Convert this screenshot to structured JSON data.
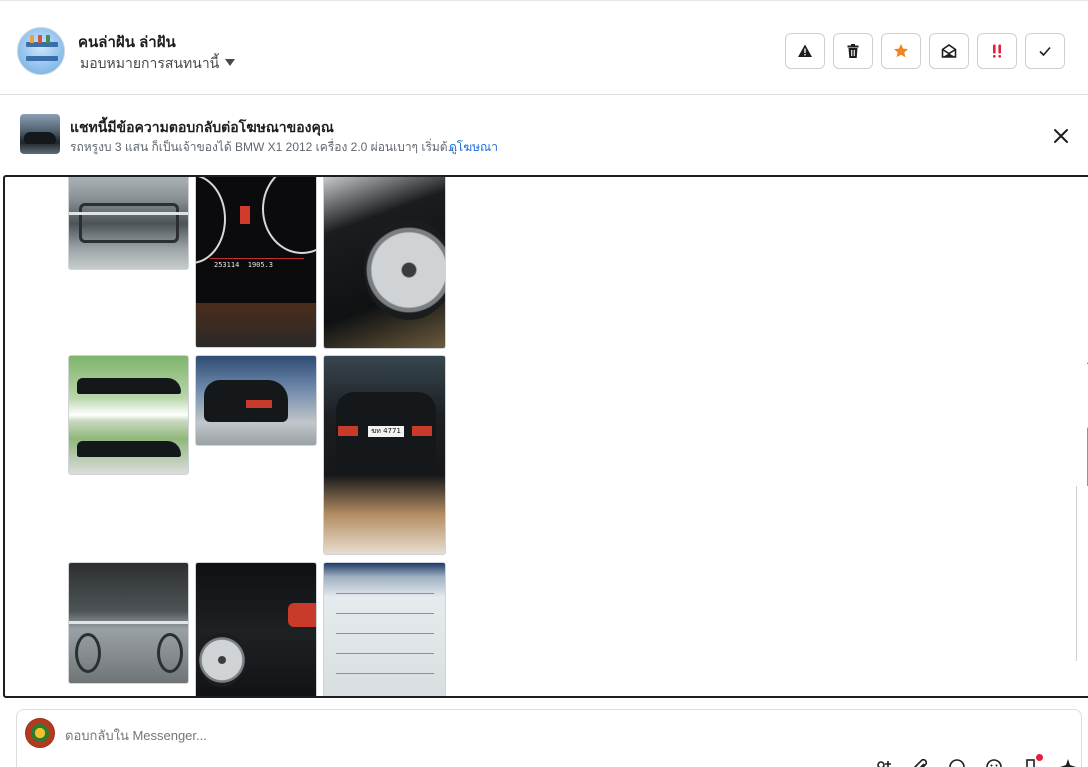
{
  "header": {
    "name": "คนล่าฝัน ล่าฝัน",
    "assign_label": "มอบหมายการสนทนานี้",
    "actions": [
      {
        "name": "report-button",
        "icon": "warning-icon"
      },
      {
        "name": "delete-button",
        "icon": "trash-icon"
      },
      {
        "name": "star-button",
        "icon": "star-icon",
        "color": "#f5821f"
      },
      {
        "name": "mark-unread-button",
        "icon": "envelope-open-icon"
      },
      {
        "name": "follow-up-button",
        "icon": "double-exclamation-icon",
        "color": "#e41e3f"
      },
      {
        "name": "done-button",
        "icon": "checkmark-icon"
      }
    ]
  },
  "banner": {
    "title": "แชทนี้มีข้อความตอบกลับต่อโฆษณาของคุณ",
    "subtitle": "รถหรูงบ 3 แสน ก็เป็นเจ้าของได้ BMW X1 2012 เครื่อง 2.0 ผ่อนเบาๆ เริ่มต้...",
    "link": "ดูโฆษณา"
  },
  "gallery": {
    "dash_reading_1": "253114",
    "dash_reading_2": "1905.3",
    "plate": "ฆท 4771"
  },
  "composer": {
    "placeholder": "ตอบกลับใน Messenger..."
  }
}
